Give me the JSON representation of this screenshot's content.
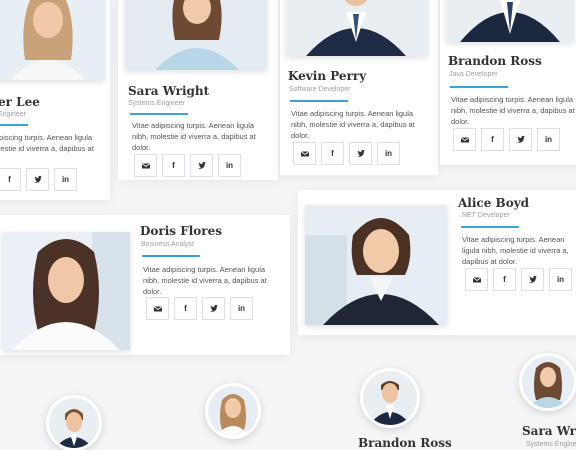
{
  "description": "Vitae adipiscing turpis. Aenean ligula nibh, molestie id viverra a, dapibus at dolor.",
  "members_row1": [
    {
      "name": "er Lee",
      "role": "Engineer"
    },
    {
      "name": "Sara Wright",
      "role": "Systems Engineer"
    },
    {
      "name": "Kevin Perry",
      "role": "Software Developer"
    },
    {
      "name": "Brandon Ross",
      "role": "Java Developer"
    }
  ],
  "members_row2": [
    {
      "name": "Doris Flores",
      "role": "Business Analyst"
    },
    {
      "name": "Alice Boyd",
      "role": ".NET Developer"
    }
  ],
  "members_row3": [
    {
      "name": "Brandon Ross",
      "role": ""
    },
    {
      "name": "Sara Wrigh",
      "role": "Systems Engine"
    }
  ],
  "social": {
    "email": "email",
    "facebook": "f",
    "twitter": "twitter",
    "linkedin": "in"
  },
  "colors": {
    "accent": "#3aa3d9",
    "background": "#f4f5f7",
    "card": "#ffffff"
  }
}
